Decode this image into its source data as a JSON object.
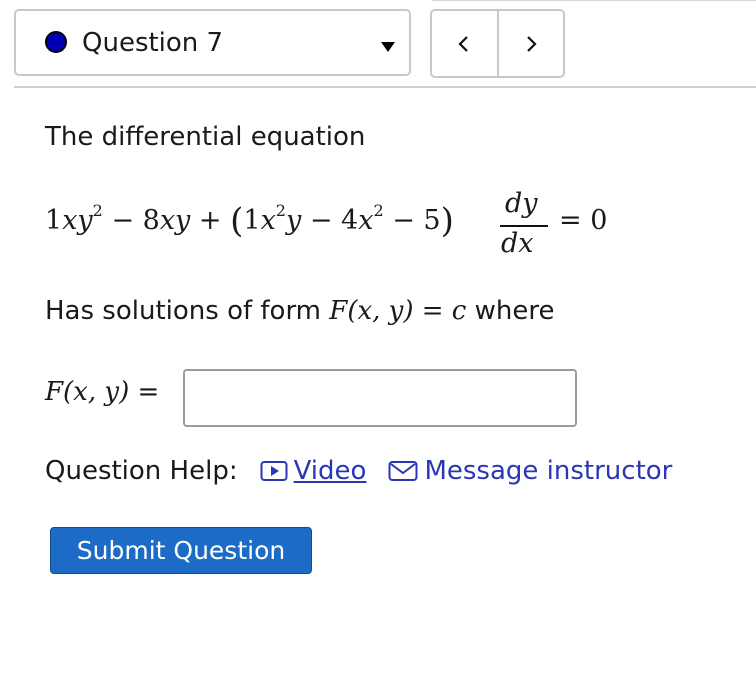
{
  "question_selector": {
    "label": "Question 7",
    "status_color": "#0000b8"
  },
  "nav": {
    "prev": "<",
    "next": ">"
  },
  "problem": {
    "intro": "The differential equation",
    "equation": {
      "lhs": "1xy² − 8xy + (1x²y − 4x² − 5)",
      "fraction_numerator": "dy",
      "fraction_denominator": "dx",
      "rhs": "= 0"
    },
    "form_prefix": "Has solutions of form",
    "form_math": "F(x, y) = c",
    "form_suffix": "where"
  },
  "answer": {
    "label_math": "F(x, y)",
    "equals": "=",
    "value": "",
    "placeholder": ""
  },
  "help": {
    "label": "Question Help:",
    "video_label": "Video",
    "message_label": "Message instructor"
  },
  "submit_label": "Submit Question",
  "colors": {
    "link": "#2a36b6",
    "submit_bg": "#1b6bc7"
  }
}
